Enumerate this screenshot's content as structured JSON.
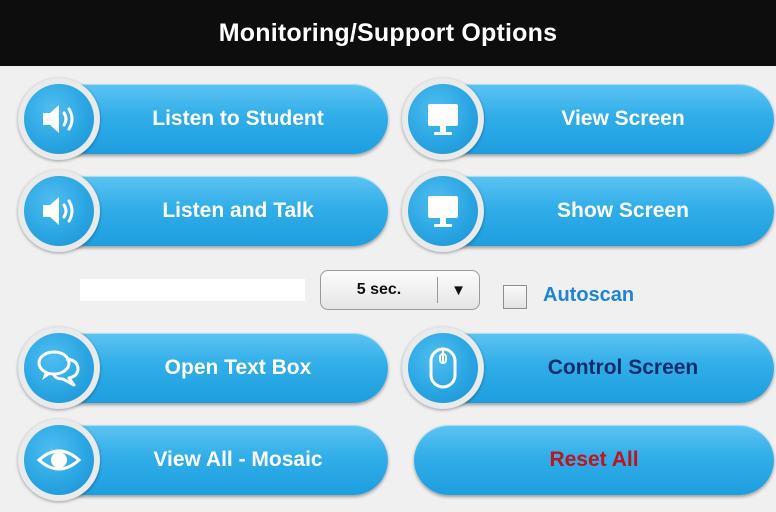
{
  "title": "Monitoring/Support Options",
  "buttons": {
    "listen_student": "Listen to Student",
    "view_screen": "View Screen",
    "listen_talk": "Listen and Talk",
    "show_screen": "Show Screen",
    "open_text_box": "Open Text Box",
    "control_screen": "Control Screen",
    "view_all_mosaic": "View All - Mosaic",
    "reset_all": "Reset All"
  },
  "autoscan": {
    "interval_selected": "5 sec.",
    "dropdown_arrow": "▼",
    "checkbox_label": "Autoscan",
    "checked": false
  },
  "colors": {
    "title_bar": "#0d0d0d",
    "button_blue": "#2aa6e3",
    "label_white": "#ffffff",
    "label_navy": "#0f2d6b",
    "label_red": "#c0141c",
    "link_blue": "#1e84d8"
  },
  "icons": {
    "listen_student": "speaker-icon",
    "view_screen": "monitor-icon",
    "listen_talk": "speaker-icon",
    "show_screen": "monitor-icon",
    "open_text_box": "chat-bubbles-icon",
    "control_screen": "mouse-icon",
    "view_all_mosaic": "eye-icon"
  }
}
